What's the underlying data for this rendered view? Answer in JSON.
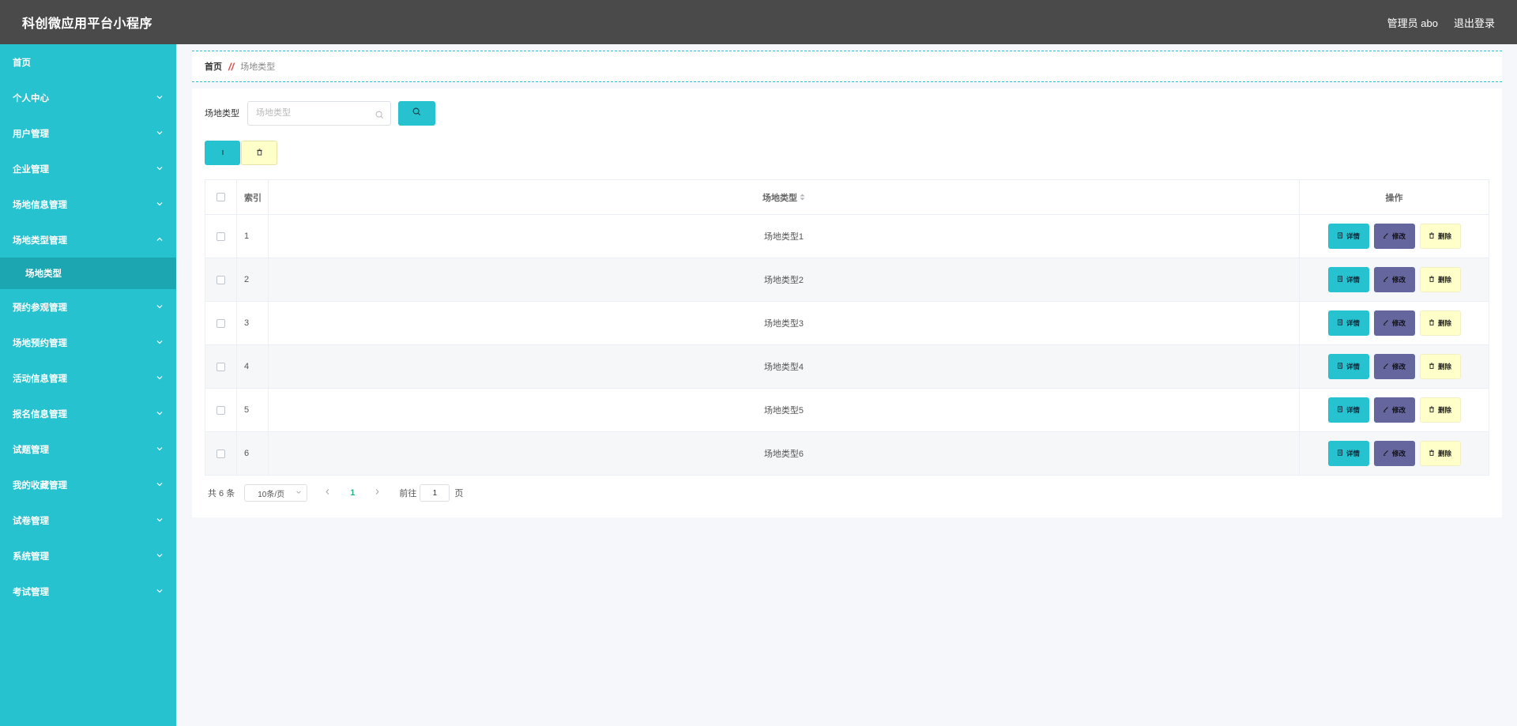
{
  "header": {
    "title": "科创微应用平台小程序",
    "user_label": "管理员 abo",
    "logout_label": "退出登录"
  },
  "sidebar": {
    "items": [
      {
        "label": "首页",
        "has_children": false
      },
      {
        "label": "个人中心",
        "has_children": true
      },
      {
        "label": "用户管理",
        "has_children": true
      },
      {
        "label": "企业管理",
        "has_children": true
      },
      {
        "label": "场地信息管理",
        "has_children": true
      },
      {
        "label": "场地类型管理",
        "has_children": true,
        "expanded": true
      },
      {
        "label": "预约参观管理",
        "has_children": true
      },
      {
        "label": "场地预约管理",
        "has_children": true
      },
      {
        "label": "活动信息管理",
        "has_children": true
      },
      {
        "label": "报名信息管理",
        "has_children": true
      },
      {
        "label": "试题管理",
        "has_children": true
      },
      {
        "label": "我的收藏管理",
        "has_children": true
      },
      {
        "label": "试卷管理",
        "has_children": true
      },
      {
        "label": "系统管理",
        "has_children": true
      },
      {
        "label": "考试管理",
        "has_children": true
      }
    ],
    "active_sub": "场地类型"
  },
  "breadcrumb": {
    "home": "首页",
    "separator": "//",
    "current": "场地类型"
  },
  "search": {
    "label": "场地类型",
    "placeholder": "场地类型",
    "value": ""
  },
  "table": {
    "headers": {
      "index": "索引",
      "type": "场地类型",
      "ops": "操作"
    },
    "rows": [
      {
        "index": "1",
        "type": "场地类型1"
      },
      {
        "index": "2",
        "type": "场地类型2"
      },
      {
        "index": "3",
        "type": "场地类型3"
      },
      {
        "index": "4",
        "type": "场地类型4"
      },
      {
        "index": "5",
        "type": "场地类型5"
      },
      {
        "index": "6",
        "type": "场地类型6"
      }
    ],
    "op_labels": {
      "detail": "详情",
      "edit": "修改",
      "delete": "删除"
    }
  },
  "pagination": {
    "total_text": "共 6 条",
    "page_size": "10条/页",
    "current_page": "1",
    "goto_label": "前往",
    "goto_value": "1",
    "page_suffix": "页"
  },
  "colors": {
    "accent": "#26c2cf",
    "header_bg": "#4a4a4a",
    "edit_button": "#66669e",
    "delete_button": "#ffffc9"
  }
}
